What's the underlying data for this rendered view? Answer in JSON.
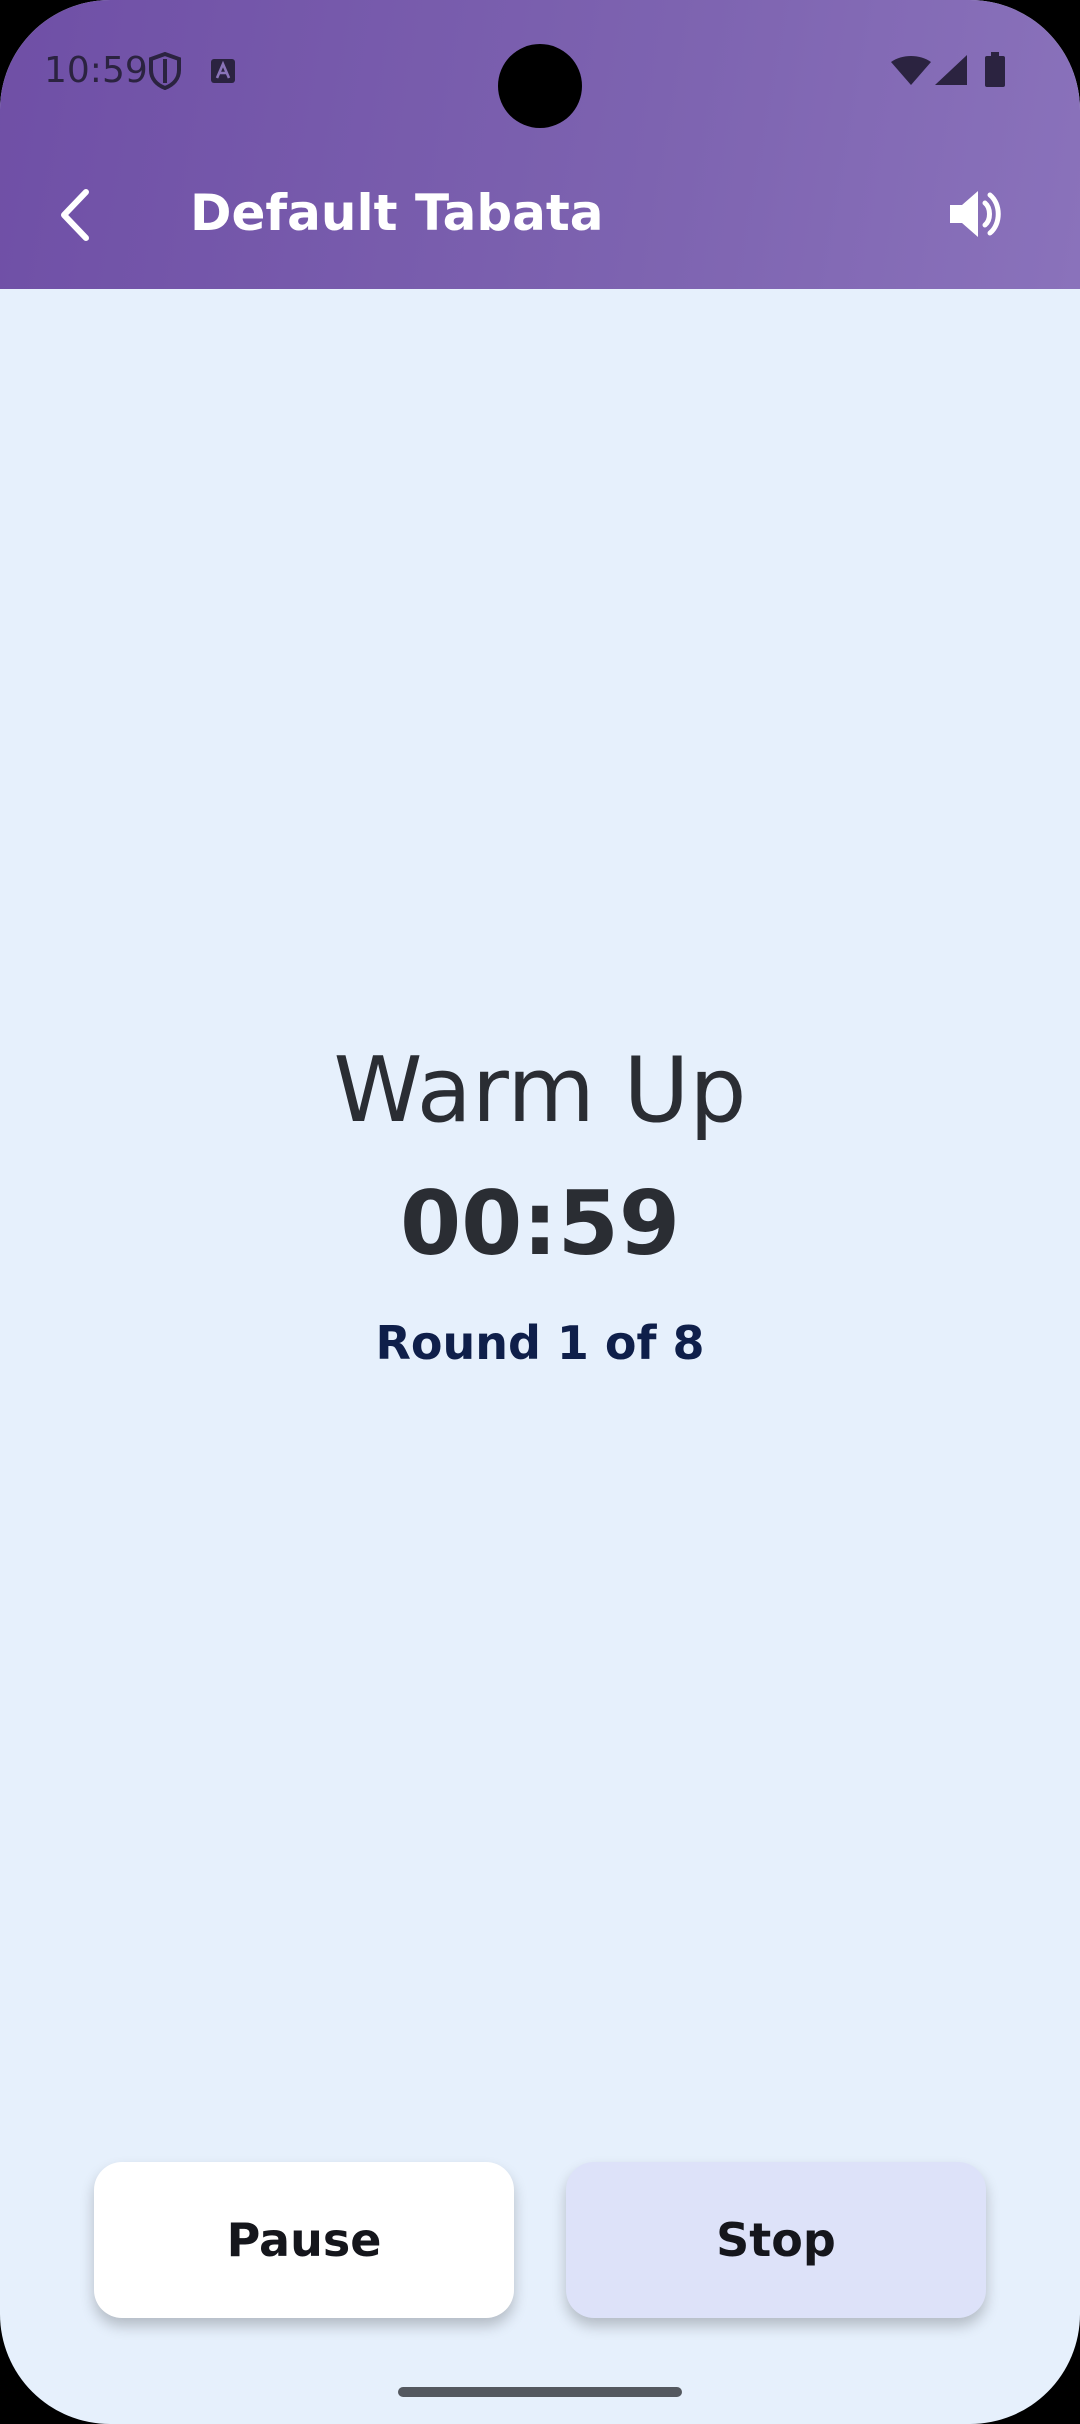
{
  "status_bar": {
    "time": "10:59",
    "icons": [
      "shield-icon",
      "keyboard-a-icon",
      "wifi-icon",
      "signal-icon",
      "battery-icon"
    ]
  },
  "app_bar": {
    "title": "Default Tabata",
    "back_icon": "chevron-left-icon",
    "sound_icon": "volume-icon"
  },
  "timer": {
    "phase": "Warm Up",
    "time": "00:59",
    "round": "Round 1 of 8"
  },
  "actions": {
    "pause_label": "Pause",
    "stop_label": "Stop"
  },
  "colors": {
    "app_bar": "#7d63b0",
    "background": "#e6f0fc",
    "pause_button": "#ffffff",
    "stop_button": "#dde2f9",
    "round_text": "#0f1f4a"
  }
}
